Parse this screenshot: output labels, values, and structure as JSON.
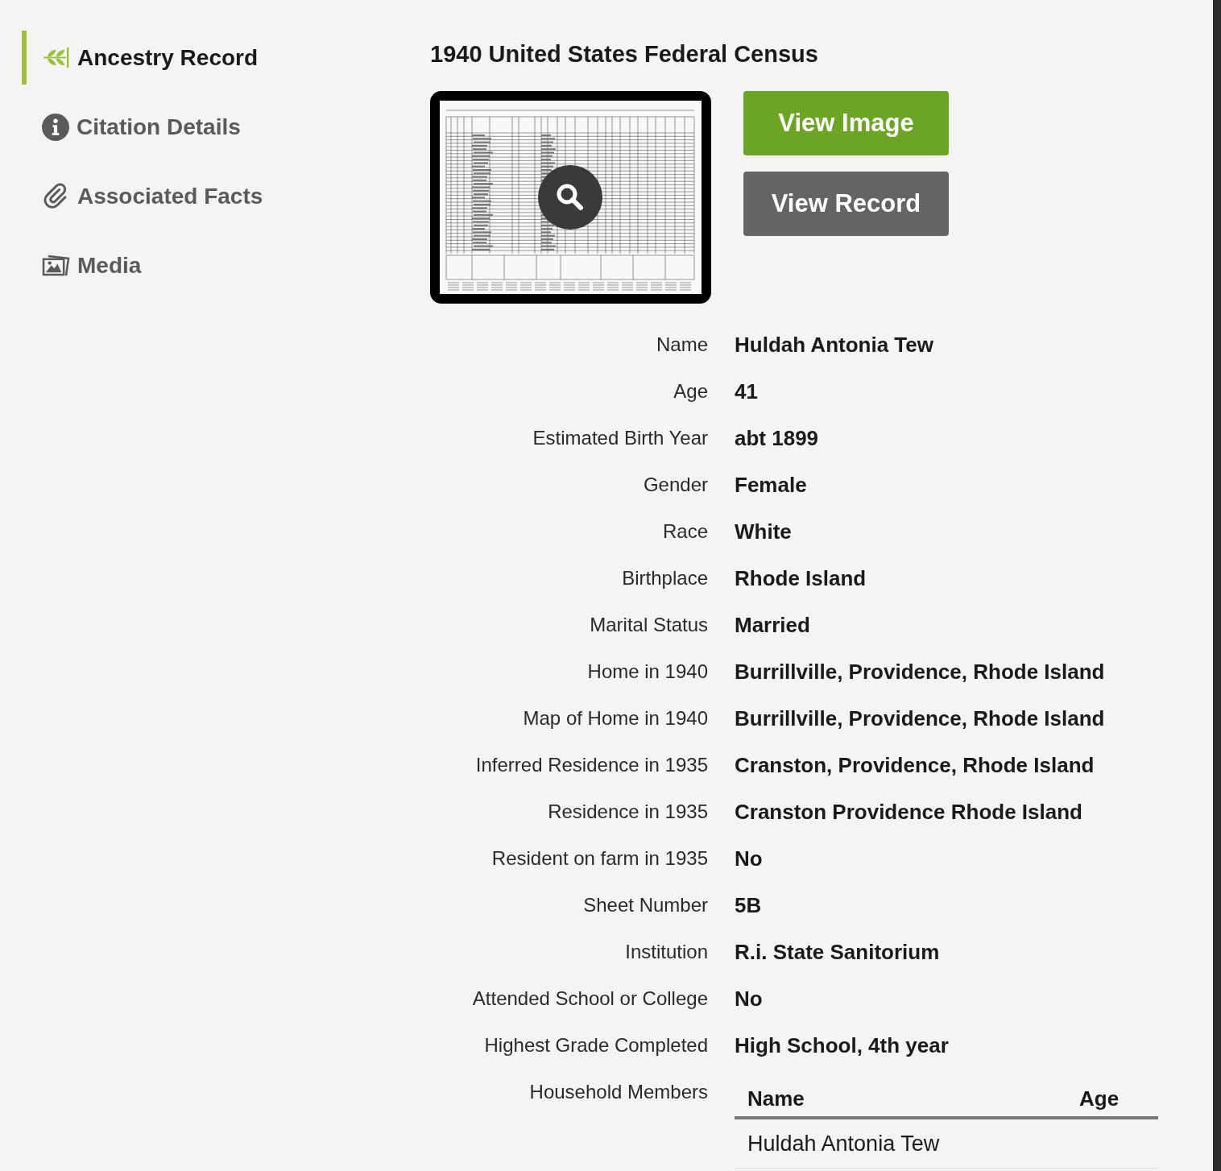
{
  "sidebar": {
    "items": [
      {
        "label": "Ancestry Record",
        "selected": true
      },
      {
        "label": "Citation Details",
        "selected": false
      },
      {
        "label": "Associated Facts",
        "selected": false
      },
      {
        "label": "Media",
        "selected": false
      }
    ]
  },
  "record": {
    "title": "1940 United States Federal Census",
    "buttons": [
      {
        "label": "View Image",
        "kind": "primary"
      },
      {
        "label": "View Record",
        "kind": "secondary"
      }
    ],
    "fields": [
      {
        "label": "Name",
        "value": "Huldah Antonia Tew"
      },
      {
        "label": "Age",
        "value": "41"
      },
      {
        "label": "Estimated Birth Year",
        "value": "abt 1899"
      },
      {
        "label": "Gender",
        "value": "Female"
      },
      {
        "label": "Race",
        "value": "White"
      },
      {
        "label": "Birthplace",
        "value": "Rhode Island"
      },
      {
        "label": "Marital Status",
        "value": "Married"
      },
      {
        "label": "Home in 1940",
        "value": "Burrillville, Providence, Rhode Island"
      },
      {
        "label": "Map of Home in 1940",
        "value": "Burrillville, Providence, Rhode Island"
      },
      {
        "label": "Inferred Residence in 1935",
        "value": "Cranston, Providence, Rhode Island"
      },
      {
        "label": "Residence in 1935",
        "value": "Cranston Providence Rhode Island"
      },
      {
        "label": "Resident on farm in 1935",
        "value": "No"
      },
      {
        "label": "Sheet Number",
        "value": "5B"
      },
      {
        "label": "Institution",
        "value": "R.i. State Sanitorium"
      },
      {
        "label": "Attended School or College",
        "value": "No"
      },
      {
        "label": "Highest Grade Completed",
        "value": "High School, 4th year"
      }
    ],
    "household_members": {
      "label": "Household Members",
      "columns": [
        "Name",
        "Age"
      ],
      "rows": [
        [
          "Huldah Antonia Tew"
        ]
      ]
    }
  }
}
